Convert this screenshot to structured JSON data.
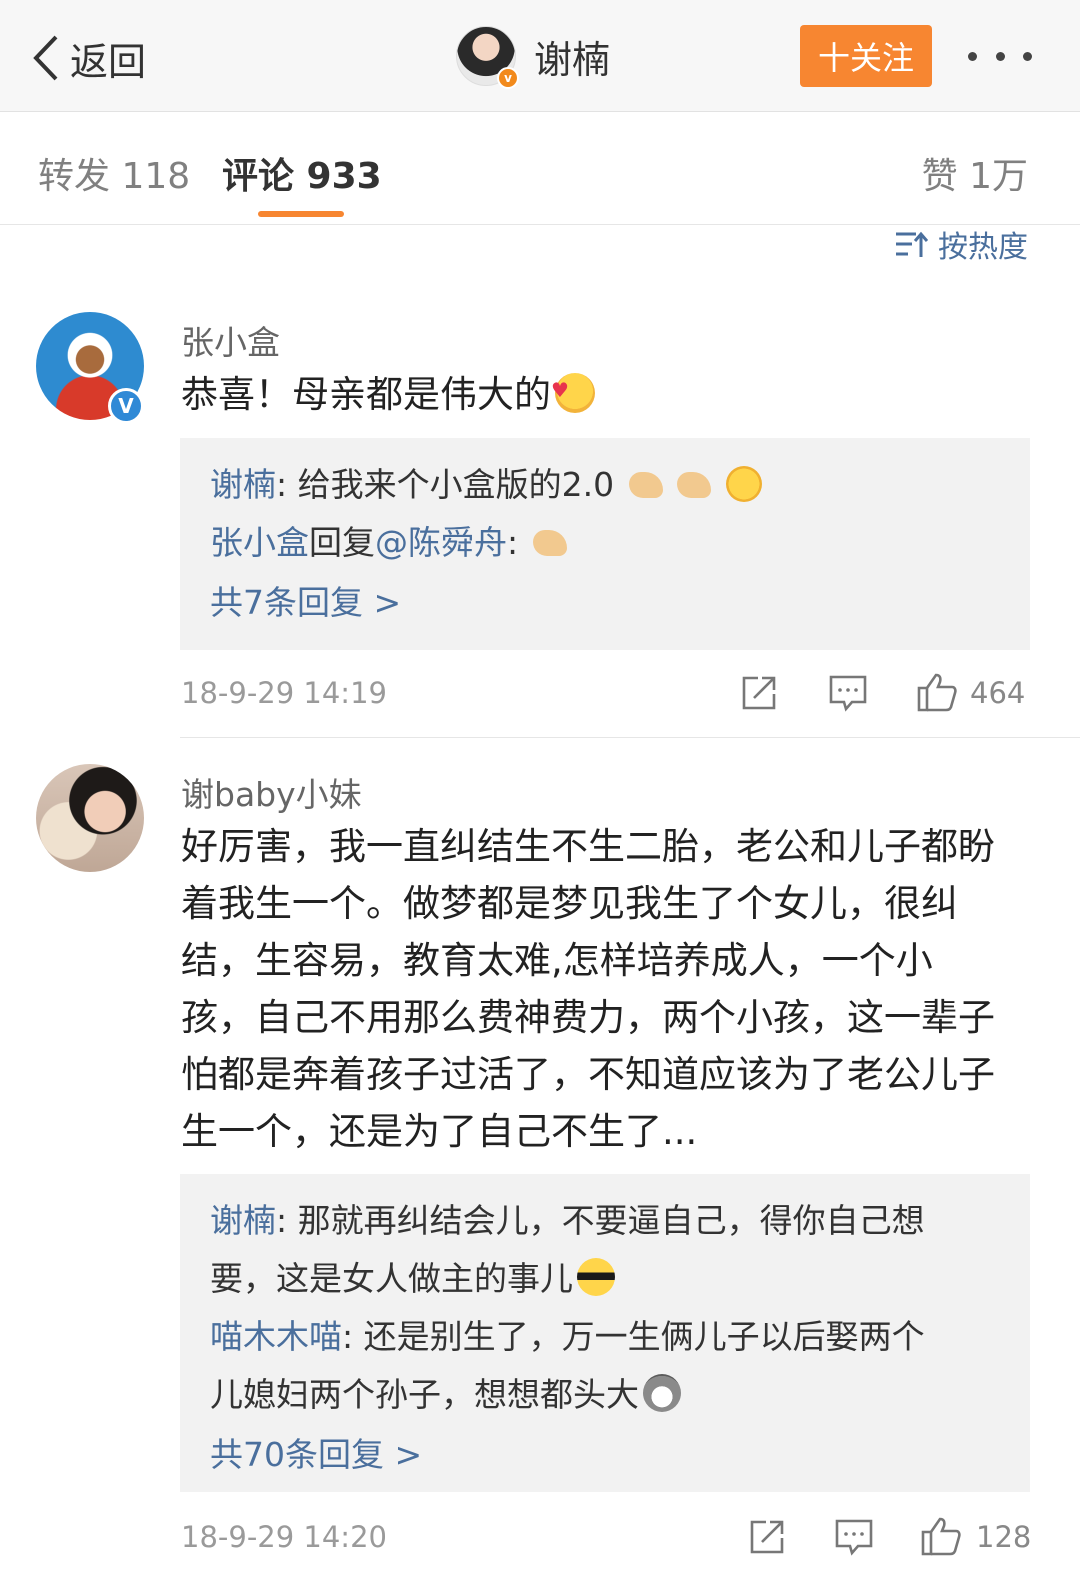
{
  "nav": {
    "back_label": "返回",
    "user_name": "谢楠",
    "verified_icon": "v-badge-orange",
    "follow_label": "十关注",
    "more_icon": "more-dots-icon"
  },
  "tabs": {
    "repost": "转发 118",
    "comments": "评论 933",
    "likes": "赞 1万",
    "active": "comments"
  },
  "sort": {
    "label": "按热度",
    "icon": "sort-icon"
  },
  "comments": [
    {
      "user": "张小盒",
      "verified": true,
      "text": "恭喜！母亲都是伟大的",
      "emoji": "blush-heart-emoji",
      "replies": [
        {
          "name": "谢楠",
          "sep": ": ",
          "text": "给我来个小盒版的2.0",
          "emojis": [
            "muscle-emoji",
            "muscle-emoji",
            "smile-emoji"
          ]
        },
        {
          "name": "张小盒",
          "middle": "回复",
          "mention": "@陈舜舟",
          "sep": ":",
          "text": "",
          "emojis": [
            "pray-emoji"
          ]
        }
      ],
      "more_replies": "共7条回复 >",
      "time": "18-9-29 14:19",
      "likes": "464"
    },
    {
      "user": "谢baby小妹",
      "verified": false,
      "text_lines": [
        "好厉害，我一直纠结生不生二胎，老公和儿子都盼",
        "着我生一个。做梦都是梦见我生了个女儿，很纠",
        "结，生容易，教育太难,怎样培养成人，一个小",
        "孩，自己不用那么费神费力，两个小孩，这一辈子",
        "怕都是奔着孩子过活了，不知道应该为了老公儿子",
        "生一个，还是为了自己不生了..."
      ],
      "replies": [
        {
          "name": "谢楠",
          "sep": ": ",
          "line1": "那就再纠结会儿，不要逼自己，得你自己想",
          "line2": "要，这是女人做主的事儿",
          "emoji": "sunglasses-emoji"
        },
        {
          "name": "喵木木喵",
          "sep": ": ",
          "line1": "还是别生了，万一生俩儿子以后娶两个",
          "line2": "儿媳妇两个孙子，想想都头大",
          "emoji": "husky-emoji"
        }
      ],
      "more_replies": "共70条回复 >",
      "time": "18-9-29 14:20",
      "likes": "128"
    }
  ],
  "action_icons": [
    "share-icon",
    "comment-icon",
    "thumbs-up-icon"
  ]
}
